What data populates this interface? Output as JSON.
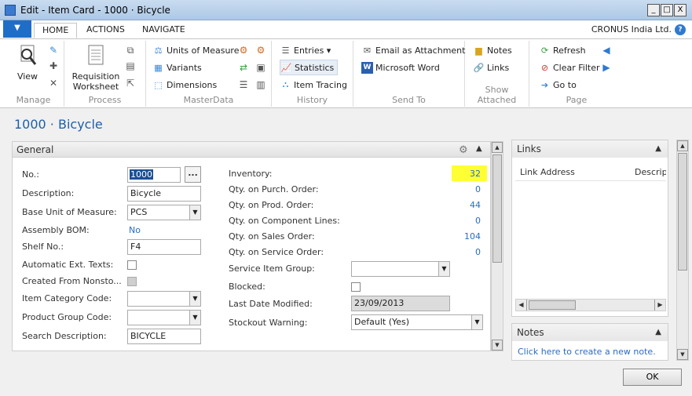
{
  "window": {
    "title": "Edit - Item Card - 1000 · Bicycle",
    "minimize": "_",
    "maximize": "□",
    "close": "X"
  },
  "ribbon": {
    "file_arrow": "▼",
    "tabs": [
      "HOME",
      "ACTIONS",
      "NAVIGATE"
    ],
    "company": "CRONUS India Ltd.",
    "help": "?",
    "groups": {
      "manage": {
        "label": "Manage",
        "view": "View"
      },
      "process": {
        "label": "Process",
        "requisition_worksheet_line1": "Requisition",
        "requisition_worksheet_line2": "Worksheet"
      },
      "masterdata": {
        "label": "MasterData",
        "units_of_measure": "Units of Measure",
        "variants": "Variants",
        "dimensions": "Dimensions"
      },
      "history": {
        "label": "History",
        "entries": "Entries ▾",
        "statistics": "Statistics",
        "item_tracing": "Item Tracing"
      },
      "sendto": {
        "label": "Send To",
        "email_as_attachment": "Email as Attachment",
        "microsoft_word": "Microsoft Word"
      },
      "show_attached": {
        "label": "Show Attached",
        "notes": "Notes",
        "links": "Links"
      },
      "page": {
        "label": "Page",
        "refresh": "Refresh",
        "clear_filter": "Clear Filter",
        "go_to": "Go to"
      }
    }
  },
  "page_title": "1000 · Bicycle",
  "general": {
    "header": "General",
    "left_fields": {
      "no": {
        "label": "No.:",
        "value": "1000",
        "button": "..."
      },
      "description": {
        "label": "Description:",
        "value": "Bicycle"
      },
      "base_unit": {
        "label": "Base Unit of Measure:",
        "value": "PCS"
      },
      "assembly_bom": {
        "label": "Assembly BOM:",
        "value": "No"
      },
      "shelf_no": {
        "label": "Shelf No.:",
        "value": "F4"
      },
      "auto_ext_texts": {
        "label": "Automatic Ext. Texts:",
        "checked": false
      },
      "created_from_nonstock": {
        "label": "Created From Nonsto...",
        "checked": false
      },
      "item_category_code": {
        "label": "Item Category Code:",
        "value": ""
      },
      "product_group_code": {
        "label": "Product Group Code:",
        "value": ""
      },
      "search_description": {
        "label": "Search Description:",
        "value": "BICYCLE"
      }
    },
    "right_fields": {
      "inventory": {
        "label": "Inventory:",
        "value": "32"
      },
      "qty_purch_order": {
        "label": "Qty. on Purch. Order:",
        "value": "0"
      },
      "qty_prod_order": {
        "label": "Qty. on Prod. Order:",
        "value": "44"
      },
      "qty_component_lines": {
        "label": "Qty. on Component Lines:",
        "value": "0"
      },
      "qty_sales_order": {
        "label": "Qty. on Sales Order:",
        "value": "104"
      },
      "qty_service_order": {
        "label": "Qty. on Service Order:",
        "value": "0"
      },
      "service_item_group": {
        "label": "Service Item Group:",
        "value": ""
      },
      "blocked": {
        "label": "Blocked:",
        "checked": false
      },
      "last_date_modified": {
        "label": "Last Date Modified:",
        "value": "23/09/2013"
      },
      "stockout_warning": {
        "label": "Stockout Warning:",
        "value": "Default (Yes)"
      }
    },
    "highlight_color": "#ffff33"
  },
  "factbox": {
    "links": {
      "header": "Links",
      "col_link_address": "Link Address",
      "col_description": "Descripti"
    },
    "notes": {
      "header": "Notes",
      "create_link": "Click here to create a new note."
    }
  },
  "ok_button": "OK",
  "colors": {
    "accent": "#1e6ec8",
    "link": "#2a6cc4",
    "title": "#1e5fa8"
  }
}
